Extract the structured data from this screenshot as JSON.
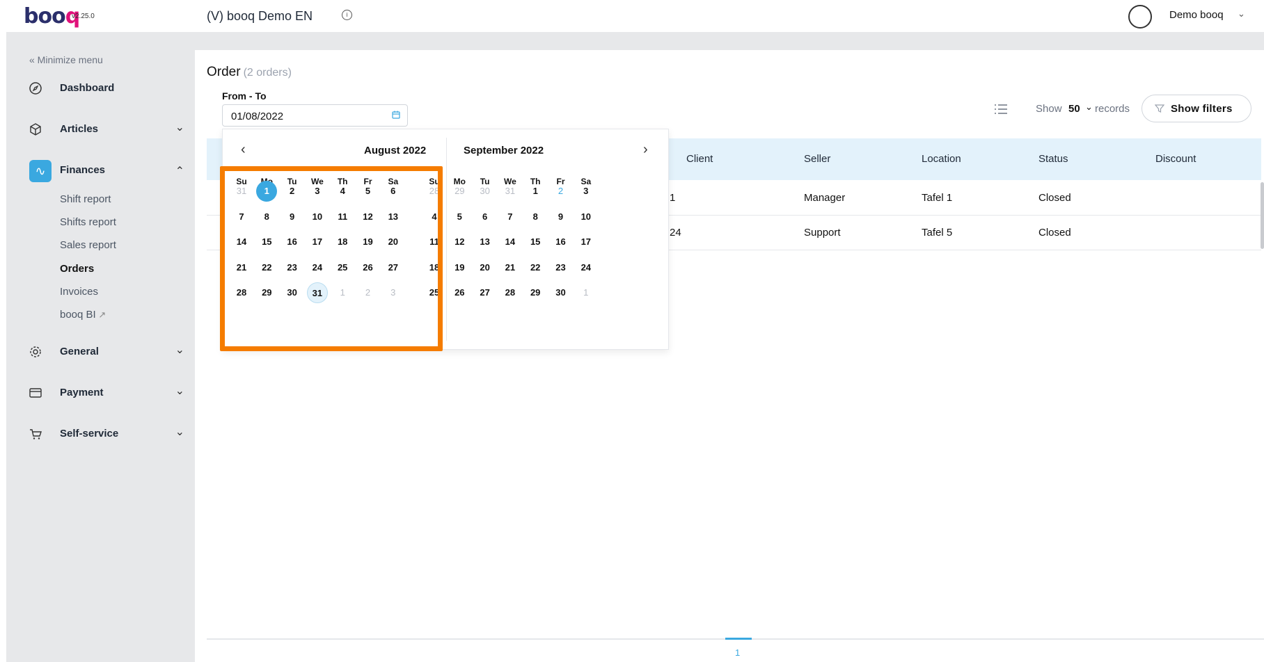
{
  "app": {
    "logo": "booq",
    "version": "v2.25.0",
    "venue": "(V) booq Demo EN",
    "user": "Demo booq"
  },
  "sidebar": {
    "minimize": "« Minimize menu",
    "items": [
      {
        "label": "Dashboard",
        "icon": "compass-icon"
      },
      {
        "label": "Articles",
        "icon": "box-icon"
      },
      {
        "label": "Finances",
        "icon": "pulse-icon"
      },
      {
        "label": "General",
        "icon": "gear-icon"
      },
      {
        "label": "Payment",
        "icon": "card-icon"
      },
      {
        "label": "Self-service",
        "icon": "cart-icon"
      }
    ],
    "finance_sub": [
      "Shift report",
      "Shifts report",
      "Sales report",
      "Orders",
      "Invoices",
      "booq BI"
    ]
  },
  "page": {
    "title": "Order",
    "count": "(2 orders)",
    "date_label": "From - To",
    "date_value": "01/08/2022",
    "show_label": "Show",
    "show_value": "50",
    "records_label": "records",
    "filters_button": "Show filters"
  },
  "table": {
    "columns": [
      "Client",
      "Seller",
      "Location",
      "Status",
      "Discount"
    ],
    "rows": [
      {
        "client_fragment": "1",
        "seller": "Manager",
        "location": "Tafel 1",
        "status": "Closed"
      },
      {
        "client_fragment": "24",
        "seller": "Support",
        "location": "Tafel 5",
        "status": "Closed"
      }
    ]
  },
  "pagination": {
    "current": "1"
  },
  "calendar": {
    "weekdays": [
      "Su",
      "Mo",
      "Tu",
      "We",
      "Th",
      "Fr",
      "Sa"
    ],
    "left": {
      "title": "August 2022",
      "weeks": [
        [
          "31",
          "1",
          "2",
          "3",
          "4",
          "5",
          "6"
        ],
        [
          "7",
          "8",
          "9",
          "10",
          "11",
          "12",
          "13"
        ],
        [
          "14",
          "15",
          "16",
          "17",
          "18",
          "19",
          "20"
        ],
        [
          "21",
          "22",
          "23",
          "24",
          "25",
          "26",
          "27"
        ],
        [
          "28",
          "29",
          "30",
          "31",
          "1",
          "2",
          "3"
        ]
      ]
    },
    "right": {
      "title": "September 2022",
      "weeks": [
        [
          "28",
          "29",
          "30",
          "31",
          "1",
          "2",
          "3"
        ],
        [
          "4",
          "5",
          "6",
          "7",
          "8",
          "9",
          "10"
        ],
        [
          "11",
          "12",
          "13",
          "14",
          "15",
          "16",
          "17"
        ],
        [
          "18",
          "19",
          "20",
          "21",
          "22",
          "23",
          "24"
        ],
        [
          "25",
          "26",
          "27",
          "28",
          "29",
          "30",
          "1"
        ]
      ]
    }
  },
  "colors": {
    "accent": "#3aa8e0",
    "highlight": "#f57c00",
    "brand": "#2b2f6b"
  }
}
